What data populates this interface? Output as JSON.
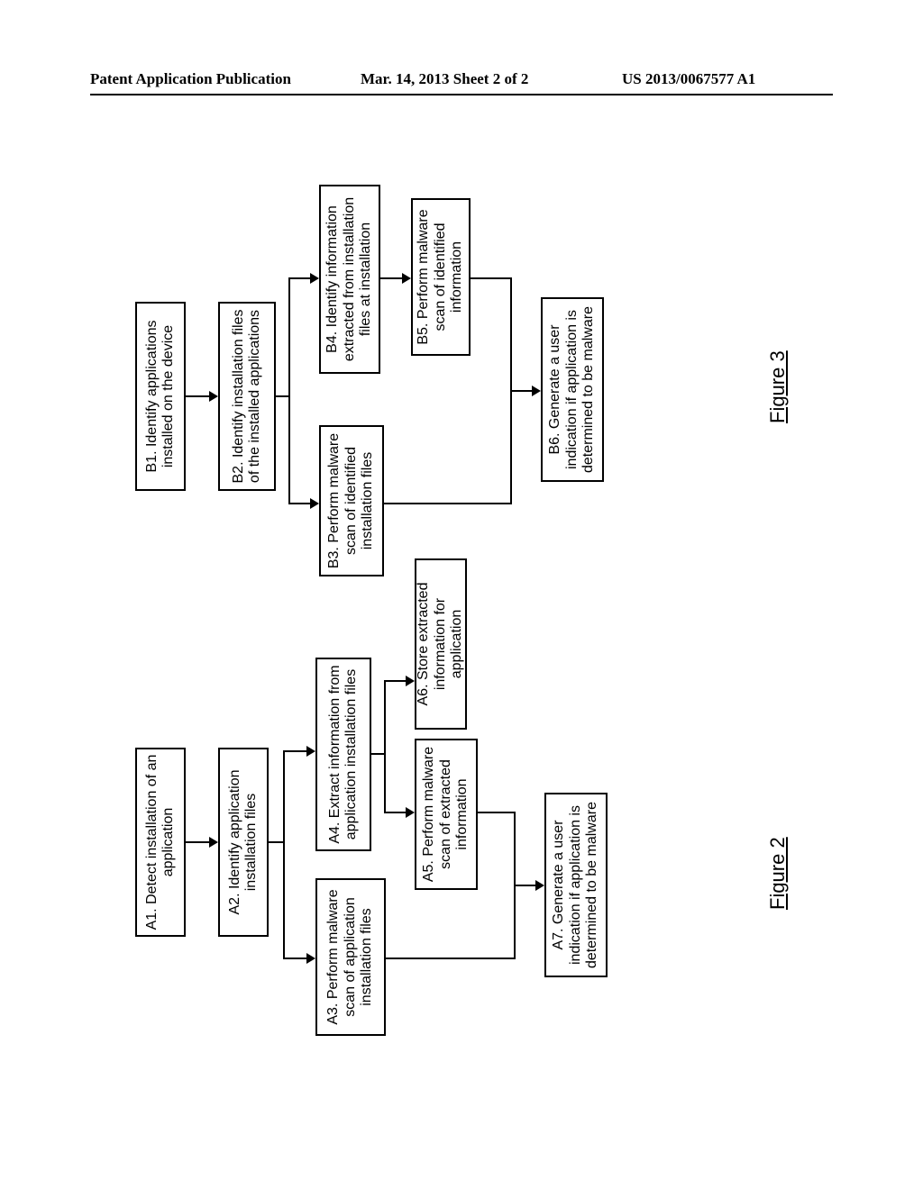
{
  "header": {
    "left": "Patent Application Publication",
    "mid": "Mar. 14, 2013  Sheet 2 of 2",
    "right": "US 2013/0067577 A1"
  },
  "figure2": {
    "label": "Figure 2",
    "A1": "A1. Detect installation of an application",
    "A2": "A2. Identify application installation files",
    "A3": "A3. Perform malware scan of application installation files",
    "A4": "A4. Extract information from application installation files",
    "A5": "A5. Perform malware scan of extracted information",
    "A6": "A6. Store extracted information for application",
    "A7": "A7. Generate a user indication if application is determined to be malware"
  },
  "figure3": {
    "label": "Figure 3",
    "B1": "B1. Identify applications installed on the device",
    "B2": "B2. Identify installation files of the installed applications",
    "B3": "B3. Perform malware scan of identified installation files",
    "B4": "B4. Identify information extracted from installation files at installation",
    "B5": "B5. Perform malware scan of identified information",
    "B6": "B6. Generate a user indication if application is determined to be malware"
  }
}
